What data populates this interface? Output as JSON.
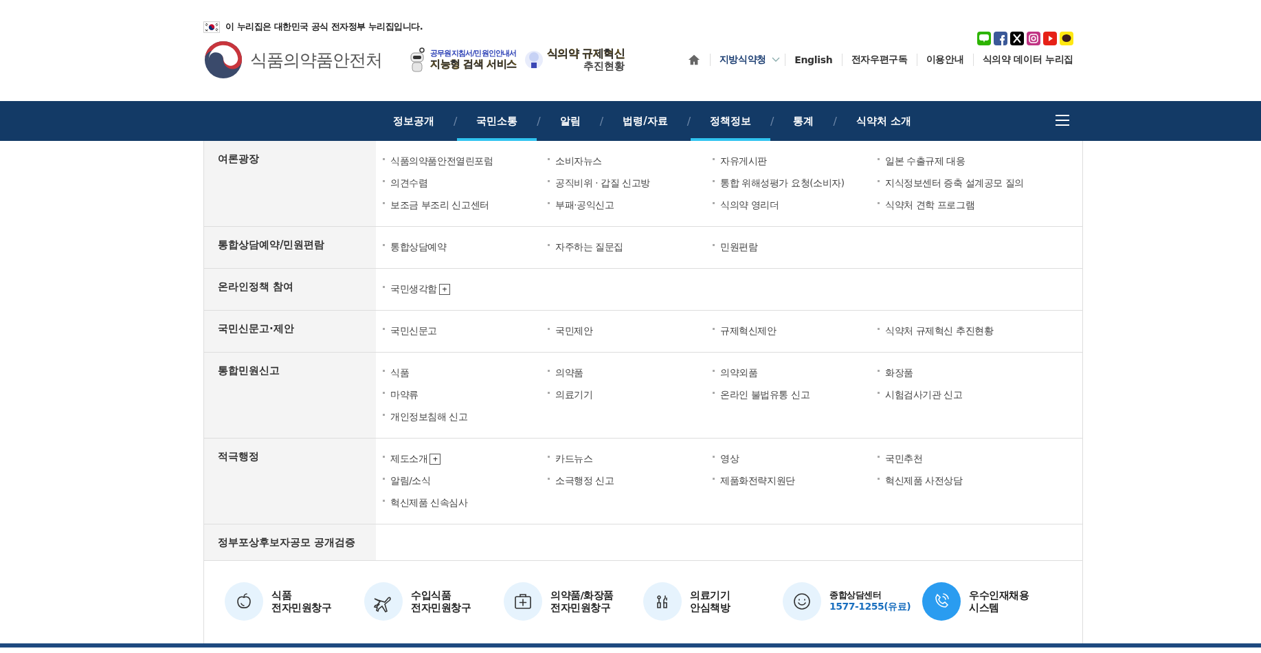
{
  "notice": "이 누리집은 대한민국 공식 전자정부 누리집입니다.",
  "logo": "식품의약품안전처",
  "banners": [
    {
      "kind": "search",
      "top": "공무원지침서/민원인안내서",
      "bottom": "지능형 검색 서비스"
    },
    {
      "kind": "reform",
      "top": "식의약 규제혁신",
      "bottom": "추진현황"
    }
  ],
  "util_links": [
    {
      "label": "지방식약청",
      "dropdown": true
    },
    {
      "label": "English",
      "dropdown": false
    },
    {
      "label": "전자우편구독",
      "dropdown": false
    },
    {
      "label": "이용안내",
      "dropdown": false
    },
    {
      "label": "식의약 데이터 누리집",
      "dropdown": false
    }
  ],
  "nav": [
    {
      "label": "정보공개",
      "selected": false
    },
    {
      "label": "국민소통",
      "selected": true
    },
    {
      "label": "알림",
      "selected": false
    },
    {
      "label": "법령/자료",
      "selected": false
    },
    {
      "label": "정책정보",
      "selected": true
    },
    {
      "label": "통계",
      "selected": false
    },
    {
      "label": "식약처 소개",
      "selected": false
    }
  ],
  "nav_separator": "/",
  "sections": [
    {
      "title": "여론광장",
      "items": [
        {
          "label": "식품의약품안전열린포럼"
        },
        {
          "label": "소비자뉴스"
        },
        {
          "label": "자유게시판"
        },
        {
          "label": "일본 수출규제 대응"
        },
        {
          "label": "의견수렴"
        },
        {
          "label": "공직비위 · 갑질 신고방"
        },
        {
          "label": "통합 위해성평가 요청(소비자)"
        },
        {
          "label": "지식정보센터 증축 설계공모 질의"
        },
        {
          "label": "보조금 부조리 신고센터"
        },
        {
          "label": "부패·공익신고"
        },
        {
          "label": "식의약 영리더"
        },
        {
          "label": "식약처 견학 프로그램"
        }
      ]
    },
    {
      "title": "통합상담예약/민원편람",
      "items": [
        {
          "label": "통합상담예약"
        },
        {
          "label": "자주하는 질문집"
        },
        {
          "label": "민원편람"
        }
      ]
    },
    {
      "title": "온라인정책 참여",
      "items": [
        {
          "label": "국민생각함",
          "toggle": "+"
        }
      ]
    },
    {
      "title": "국민신문고·제안",
      "items": [
        {
          "label": "국민신문고"
        },
        {
          "label": "국민제안"
        },
        {
          "label": "규제혁신제안"
        },
        {
          "label": "식약처 규제혁신 추진현황"
        }
      ]
    },
    {
      "title": "통합민원신고",
      "items": [
        {
          "label": "식품"
        },
        {
          "label": "의약품"
        },
        {
          "label": "의약외품"
        },
        {
          "label": "화장품"
        },
        {
          "label": "마약류"
        },
        {
          "label": "의료기기"
        },
        {
          "label": "온라인 불법유통 신고"
        },
        {
          "label": "시험검사기관 신고"
        },
        {
          "label": "개인정보침해 신고"
        }
      ]
    },
    {
      "title": "적극행정",
      "items": [
        {
          "label": "제도소개",
          "toggle": "+"
        },
        {
          "label": "카드뉴스"
        },
        {
          "label": "영상"
        },
        {
          "label": "국민추천"
        },
        {
          "label": "알림/소식"
        },
        {
          "label": "소극행정 신고"
        },
        {
          "label": "제품화전략지원단"
        },
        {
          "label": "혁신제품 사전상담"
        },
        {
          "label": "혁신제품 신속심사"
        }
      ]
    },
    {
      "title": "정부포상후보자공모 공개검증"
    }
  ],
  "quick_links": [
    {
      "kind": "text",
      "lines": [
        "식품",
        "전자민원창구"
      ],
      "featured": false
    },
    {
      "kind": "text",
      "lines": [
        "수입식품",
        "전자민원창구"
      ],
      "featured": false
    },
    {
      "kind": "text",
      "lines": [
        "의약품/화장품",
        "전자민원창구"
      ],
      "featured": false
    },
    {
      "kind": "text",
      "lines": [
        "의료기기",
        "안심책방"
      ],
      "featured": false
    },
    {
      "kind": "phone",
      "lines": [
        "종합상담센터",
        "1577-1255(유료)"
      ],
      "featured": false
    },
    {
      "kind": "text",
      "lines": [
        "우수인재채용",
        "시스템"
      ],
      "featured": true
    }
  ]
}
